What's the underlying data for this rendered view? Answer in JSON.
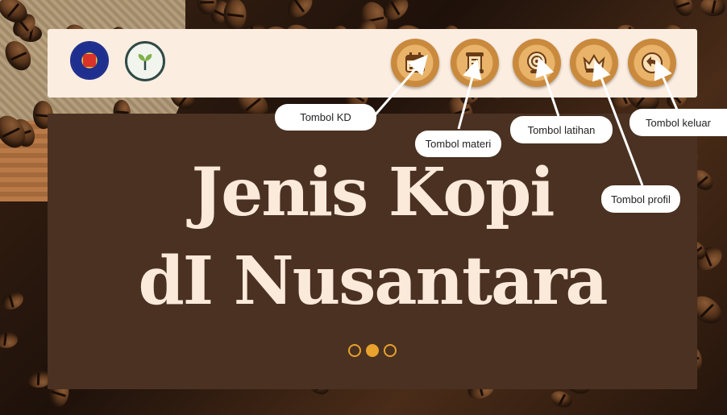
{
  "header": {
    "logos": [
      {
        "name": "uny-logo"
      },
      {
        "name": "lab-logo"
      }
    ],
    "buttons": [
      {
        "name": "kd-button",
        "icon": "calendar-icon"
      },
      {
        "name": "materi-button",
        "icon": "scroll-icon"
      },
      {
        "name": "latihan-button",
        "icon": "target-icon"
      },
      {
        "name": "profil-button",
        "icon": "crown-icon"
      },
      {
        "name": "keluar-button",
        "icon": "back-arrow-icon"
      }
    ]
  },
  "callouts": {
    "kd": "Tombol KD",
    "materi": "Tombol materi",
    "latihan": "Tombol latihan",
    "keluar": "Tombol keluar",
    "profil": "Tombol profil"
  },
  "main": {
    "title_line1": "Jenis Kopi",
    "title_line2": "dI Nusantara",
    "slides": 3,
    "active_slide": 2
  },
  "colors": {
    "topbar": "#fcede1",
    "card": "#4a3122",
    "title": "#fbe9da",
    "accent": "#e8a22d"
  }
}
